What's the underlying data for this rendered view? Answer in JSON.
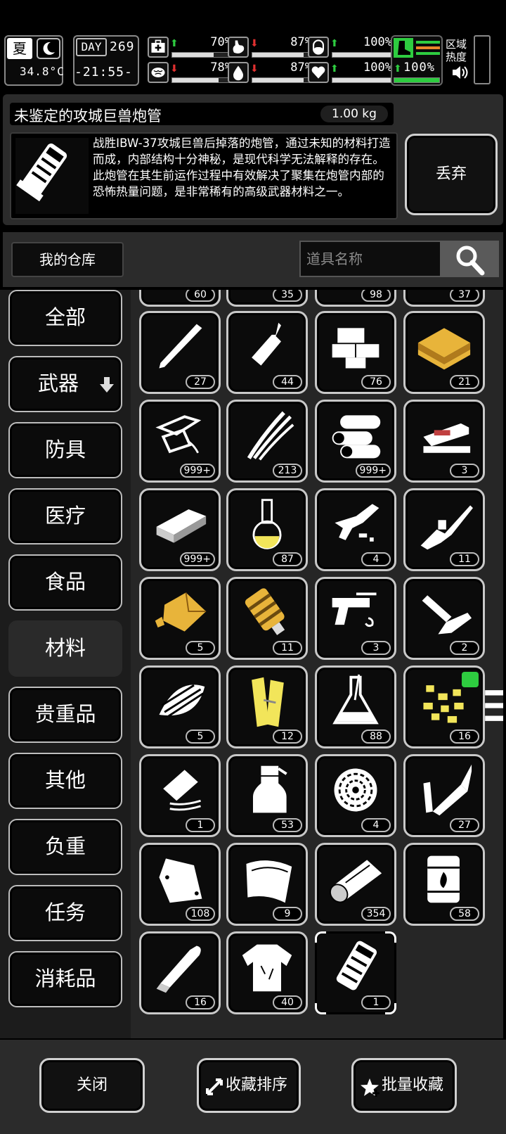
{
  "status": {
    "season": "夏",
    "day_label": "DAY",
    "day": "269",
    "temperature": "34.8°C",
    "time": "-21:55-",
    "stats": [
      {
        "id": "health",
        "icon": "medkit-icon",
        "trend": "up",
        "value": "70%",
        "level": 0.7
      },
      {
        "id": "hunger",
        "icon": "stomach-icon",
        "trend": "down",
        "value": "87%",
        "level": 0.87
      },
      {
        "id": "energy",
        "icon": "capsule-icon",
        "trend": "up",
        "value": "100%",
        "level": 1.0
      },
      {
        "id": "mental",
        "icon": "brain-icon",
        "trend": "down",
        "value": "78%",
        "level": 0.78
      },
      {
        "id": "thirst",
        "icon": "water-drop-icon",
        "trend": "down",
        "value": "87%",
        "level": 0.87
      },
      {
        "id": "mood",
        "icon": "heart-icon",
        "trend": "up",
        "value": "100%",
        "level": 1.0
      }
    ],
    "stamina": {
      "trend": "up",
      "value": "100%",
      "level": 1.0
    },
    "zone_heat_label": "区域\n热度"
  },
  "selected_item": {
    "name": "未鉴定的攻城巨兽炮管",
    "weight": "1.00 kg",
    "description": "战胜IBW-37攻城巨兽后掉落的炮管，通过未知的材料打造而成，内部结构十分神秘，是现代科学无法解释的存在。此炮管在其生前运作过程中有效解决了聚集在炮管内部的恐怖热量问题，是非常稀有的高级武器材料之一。",
    "discard_label": "丢弃"
  },
  "warehouse": {
    "label": "我的仓库",
    "search_placeholder": "道具名称"
  },
  "categories": [
    {
      "label": "全部",
      "active": false
    },
    {
      "label": "武器",
      "active": false,
      "has_arrow": true
    },
    {
      "label": "防具",
      "active": false
    },
    {
      "label": "医疗",
      "active": false
    },
    {
      "label": "食品",
      "active": false
    },
    {
      "label": "材料",
      "active": true
    },
    {
      "label": "贵重品",
      "active": false
    },
    {
      "label": "其他",
      "active": false
    },
    {
      "label": "负重",
      "active": false
    },
    {
      "label": "任务",
      "active": false
    },
    {
      "label": "消耗品",
      "active": false
    }
  ],
  "partial_row_counts": [
    "60",
    "35",
    "98",
    "37"
  ],
  "items": [
    {
      "icon": "rod-icon",
      "count": "27"
    },
    {
      "icon": "glue-bottle-icon",
      "count": "44"
    },
    {
      "icon": "wood-blocks-icon",
      "count": "76"
    },
    {
      "icon": "gold-plank-icon",
      "count": "21"
    },
    {
      "icon": "metal-scrap-icon",
      "count": "999+"
    },
    {
      "icon": "wires-icon",
      "count": "213"
    },
    {
      "icon": "cloth-rolls-icon",
      "count": "999+"
    },
    {
      "icon": "stapler-icon",
      "count": "3"
    },
    {
      "icon": "brick-icon",
      "count": "999+"
    },
    {
      "icon": "flask-yellow-icon",
      "count": "87"
    },
    {
      "icon": "rifle-parts-icon",
      "count": "4"
    },
    {
      "icon": "rifle-broken-icon",
      "count": "11"
    },
    {
      "icon": "gold-ore-icon",
      "count": "5"
    },
    {
      "icon": "cannon-core-icon",
      "count": "11"
    },
    {
      "icon": "pistol-parts-icon",
      "count": "3"
    },
    {
      "icon": "folding-knife-icon",
      "count": "2"
    },
    {
      "icon": "bamboo-bundle-icon",
      "count": "5"
    },
    {
      "icon": "gold-wood-icon",
      "count": "12"
    },
    {
      "icon": "erlenmeyer-flask-icon",
      "count": "88"
    },
    {
      "icon": "gold-nuggets-icon",
      "count": "16",
      "tag": true
    },
    {
      "icon": "circuit-clip-icon",
      "count": "1"
    },
    {
      "icon": "spray-bottle-icon",
      "count": "53"
    },
    {
      "icon": "fiber-coil-icon",
      "count": "4"
    },
    {
      "icon": "soldering-iron-icon",
      "count": "27"
    },
    {
      "icon": "plastic-bag-icon",
      "count": "108"
    },
    {
      "icon": "cloth-sheet-icon",
      "count": "9"
    },
    {
      "icon": "log-icon",
      "count": "354"
    },
    {
      "icon": "fuel-barrel-icon",
      "count": "58"
    },
    {
      "icon": "bullet-icon",
      "count": "16"
    },
    {
      "icon": "torn-shirt-icon",
      "count": "40"
    },
    {
      "icon": "cannon-barrel-icon",
      "count": "1",
      "selected": true
    }
  ],
  "bottom": {
    "close_label": "关闭",
    "sort_label": "收藏排序",
    "batch_label": "批量收藏"
  },
  "colors": {
    "trend_up": "#2ecc40",
    "trend_down": "#e03030",
    "gold": "#e8b43a",
    "yellow": "#f2e55a"
  }
}
